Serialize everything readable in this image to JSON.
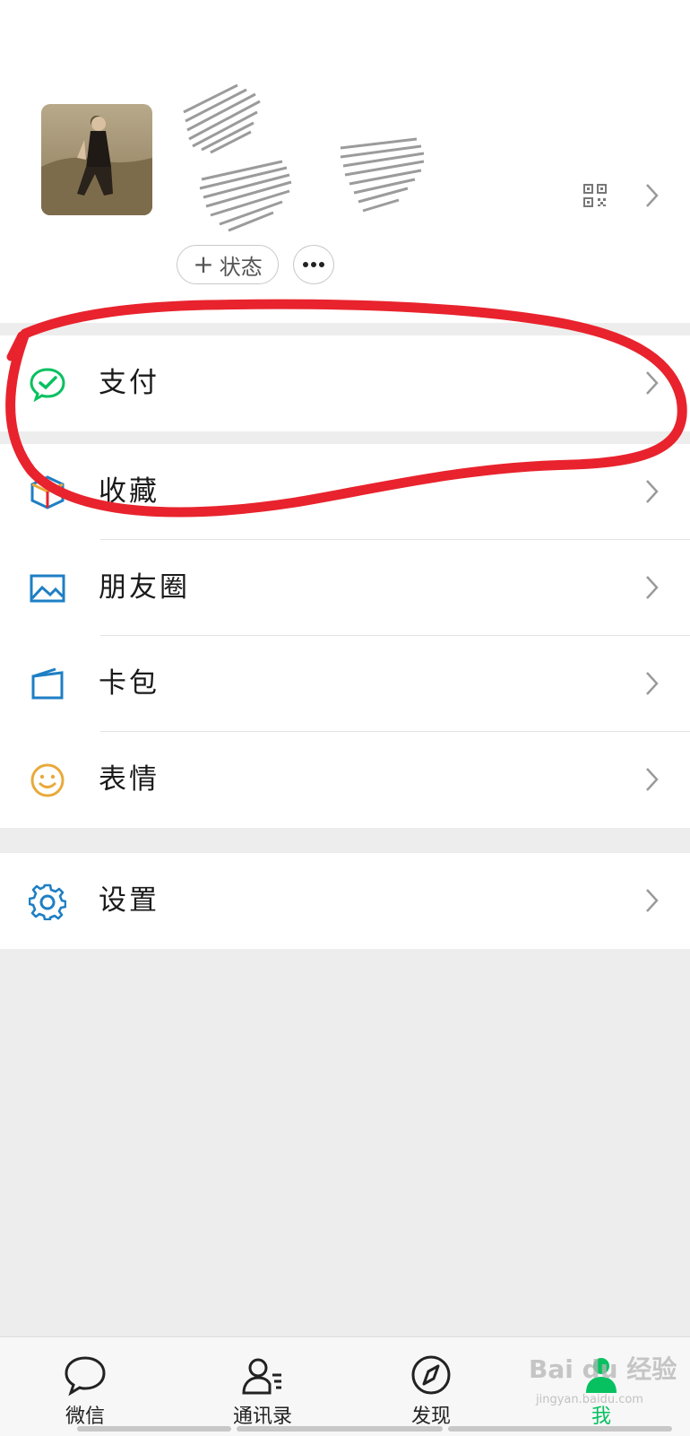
{
  "profile": {
    "status_button_label": "状态",
    "more_button_label": "•••"
  },
  "menu": {
    "group1": [
      {
        "label": "支付",
        "icon": "wechat-pay-icon"
      }
    ],
    "group2": [
      {
        "label": "收藏",
        "icon": "favorites-cube-icon"
      },
      {
        "label": "朋友圈",
        "icon": "moments-image-icon"
      },
      {
        "label": "卡包",
        "icon": "card-wallet-icon"
      },
      {
        "label": "表情",
        "icon": "smiley-icon"
      }
    ],
    "group3": [
      {
        "label": "设置",
        "icon": "gear-icon"
      }
    ]
  },
  "tabbar": {
    "tabs": [
      {
        "label": "微信",
        "icon": "chat-bubble-icon",
        "active": false
      },
      {
        "label": "通讯录",
        "icon": "contacts-icon",
        "active": false
      },
      {
        "label": "发现",
        "icon": "compass-icon",
        "active": false
      },
      {
        "label": "我",
        "icon": "person-icon",
        "active": true
      }
    ]
  },
  "watermark": {
    "brand": "Bai du 经验",
    "site": "jingyan.baidu.com"
  },
  "colors": {
    "accent_green": "#07c160",
    "annotation_red": "#e8232d",
    "icon_blue": "#1e7fc4",
    "icon_yellow": "#e9a93a"
  }
}
